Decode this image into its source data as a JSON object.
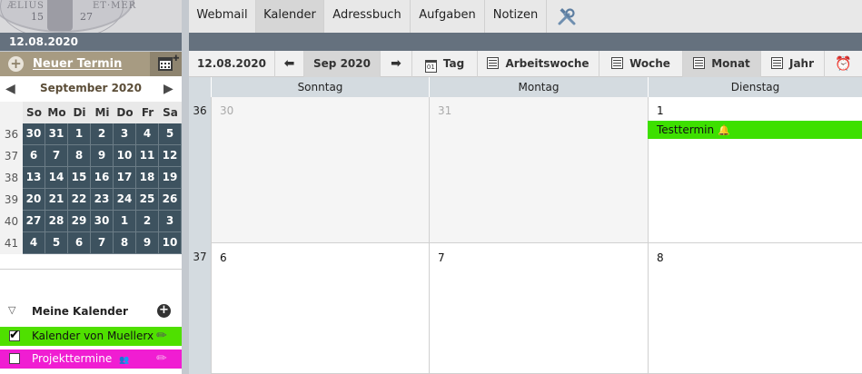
{
  "logo": {
    "left_num": "15",
    "right_num": "27",
    "rim_left": "ÆLIUS",
    "rim_right": "ET·MER"
  },
  "left": {
    "current_date": "12.08.2020",
    "new_event_label": "Neuer Termin",
    "mini_cal": {
      "month_title": "September 2020",
      "weekday_headers": [
        "So",
        "Mo",
        "Di",
        "Mi",
        "Do",
        "Fr",
        "Sa"
      ],
      "weeks": [
        {
          "wk": "36",
          "days": [
            "30",
            "31",
            "1",
            "2",
            "3",
            "4",
            "5"
          ]
        },
        {
          "wk": "37",
          "days": [
            "6",
            "7",
            "8",
            "9",
            "10",
            "11",
            "12"
          ]
        },
        {
          "wk": "38",
          "days": [
            "13",
            "14",
            "15",
            "16",
            "17",
            "18",
            "19"
          ]
        },
        {
          "wk": "39",
          "days": [
            "20",
            "21",
            "22",
            "23",
            "24",
            "25",
            "26"
          ]
        },
        {
          "wk": "40",
          "days": [
            "27",
            "28",
            "29",
            "30",
            "1",
            "2",
            "3"
          ]
        },
        {
          "wk": "41",
          "days": [
            "4",
            "5",
            "6",
            "7",
            "8",
            "9",
            "10"
          ]
        }
      ]
    },
    "my_calendars_label": "Meine Kalender",
    "calendars": [
      {
        "label": "Kalender von Muellerx",
        "color": "#4fe000",
        "checked": true
      },
      {
        "label": "Projekttermine",
        "color": "#f01dd2",
        "checked": false
      }
    ]
  },
  "topnav": {
    "items": [
      {
        "label": "Webmail"
      },
      {
        "label": "Kalender",
        "active": true
      },
      {
        "label": "Adressbuch"
      },
      {
        "label": "Aufgaben"
      },
      {
        "label": "Notizen"
      }
    ]
  },
  "toolbar": {
    "date": "12.08.2020",
    "month": "Sep 2020",
    "day_icon_num": "01",
    "day": "Tag",
    "workweek": "Arbeitswoche",
    "week": "Woche",
    "month_view": "Monat",
    "year": "Jahr"
  },
  "grid": {
    "day_headers": [
      "Sonntag",
      "Montag",
      "Dienstag"
    ],
    "weeks": [
      {
        "wk": "36",
        "days": [
          "30",
          "31",
          "1"
        ]
      },
      {
        "wk": "37",
        "days": [
          "6",
          "7",
          "8"
        ]
      }
    ],
    "event": {
      "title": "Testtermin",
      "color": "#3de000"
    }
  },
  "colors": {
    "accent": "#65717e",
    "mini_cal_day": "#3d525f",
    "new_event": "#a79b82"
  }
}
